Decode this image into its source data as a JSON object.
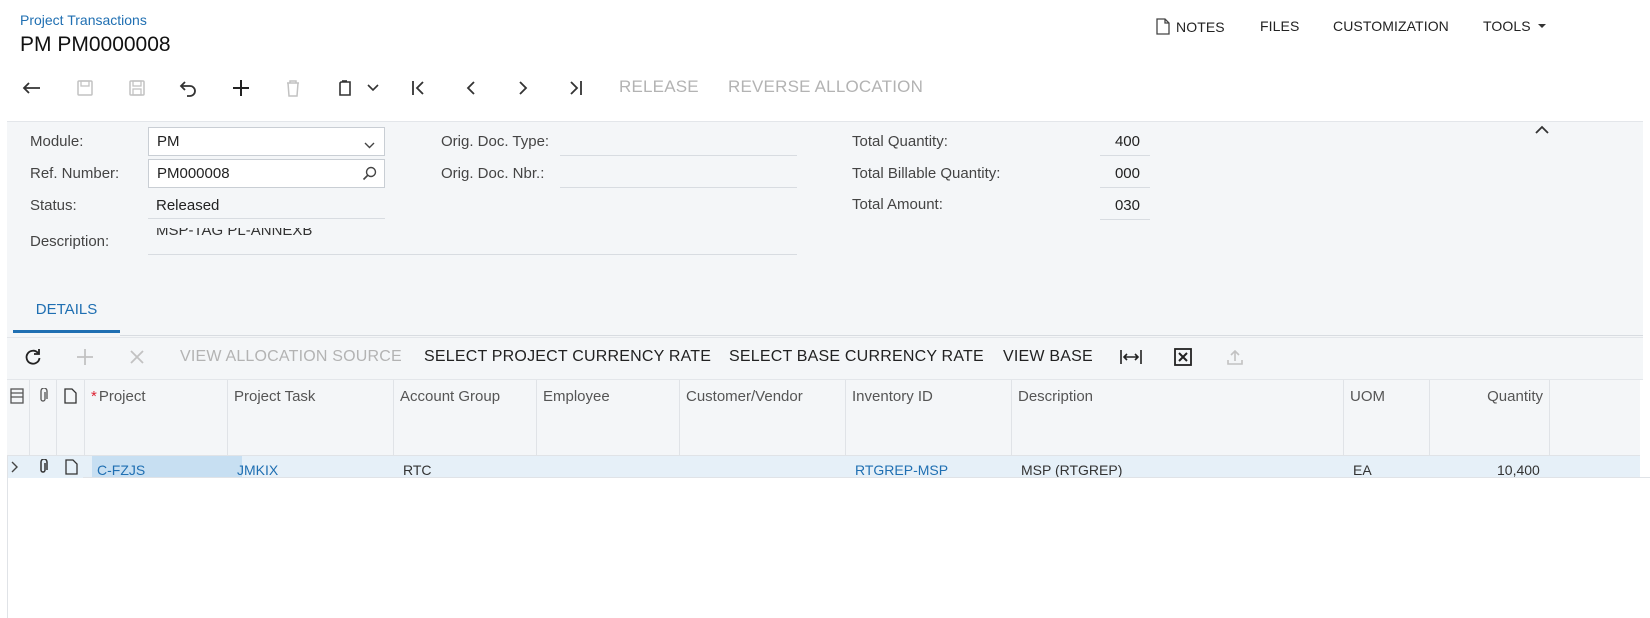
{
  "header": {
    "breadcrumb": "Project Transactions",
    "title": "PM PM0000008"
  },
  "top_menu": {
    "notes": "NOTES",
    "files": "FILES",
    "customization": "CUSTOMIZATION",
    "tools": "TOOLS"
  },
  "toolbar": {
    "release": "RELEASE",
    "reverse_allocation": "REVERSE ALLOCATION"
  },
  "form": {
    "module_label": "Module:",
    "module_value": "PM",
    "ref_label": "Ref. Number:",
    "ref_value": "PM000008",
    "status_label": "Status:",
    "status_value": "Released",
    "description_label": "Description:",
    "description_value": "MSP-TAG PL-ANNEXB",
    "orig_type_label": "Orig. Doc. Type:",
    "orig_nbr_label": "Orig. Doc. Nbr.:",
    "total_qty_label": "Total Quantity:",
    "total_qty_value": "400",
    "total_billable_label": "Total Billable Quantity:",
    "total_billable_value": "000",
    "total_amount_label": "Total Amount:",
    "total_amount_value": "030"
  },
  "tabs": {
    "details": "DETAILS"
  },
  "grid_toolbar": {
    "view_allocation_source": "VIEW ALLOCATION SOURCE",
    "select_project_currency_rate": "SELECT PROJECT CURRENCY RATE",
    "select_base_currency_rate": "SELECT BASE CURRENCY RATE",
    "view_base": "VIEW BASE"
  },
  "grid": {
    "columns": {
      "project": "Project",
      "project_task": "Project Task",
      "account_group": "Account Group",
      "employee": "Employee",
      "customer_vendor": "Customer/Vendor",
      "inventory_id": "Inventory ID",
      "description": "Description",
      "uom": "UOM",
      "quantity": "Quantity"
    },
    "row": {
      "project": "C-FZJS",
      "project_task": "JMKIX",
      "account_group": "RTC",
      "inventory_id": "RTGREP-MSP",
      "description": "MSP (RTGREP)",
      "uom": "EA",
      "quantity": "10,400"
    }
  },
  "colors": {
    "accent": "#1f6fb2",
    "disabled": "#b3b3b3",
    "panel_bg": "#f4f6f8",
    "row_highlight": "#e6f0f8"
  }
}
